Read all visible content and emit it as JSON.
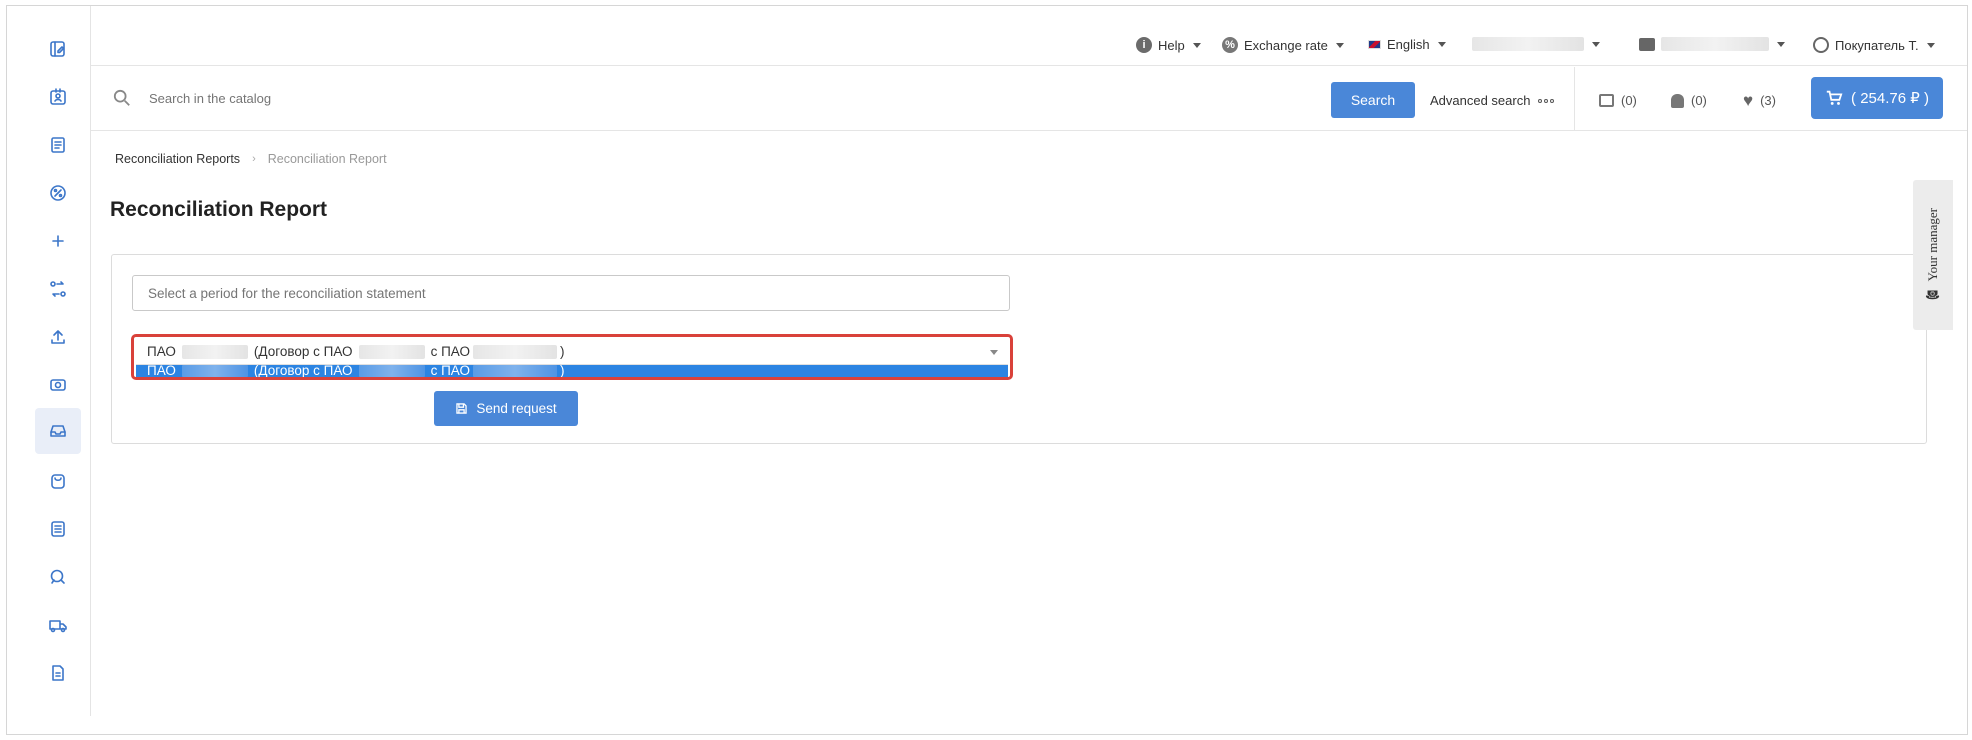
{
  "header": {
    "help_label": "Help",
    "exchange_label": "Exchange rate",
    "language_label": "English",
    "user_label": "Покупатель Т."
  },
  "search": {
    "placeholder": "Search in the catalog",
    "button_label": "Search",
    "advanced_label": "Advanced search"
  },
  "counters": {
    "compare": "(0)",
    "notifications": "(0)",
    "favorites": "(3)"
  },
  "cart": {
    "total": "( 254.76 ₽ )"
  },
  "breadcrumb": {
    "parent": "Reconciliation Reports",
    "current": "Reconciliation Report"
  },
  "page": {
    "title": "Reconciliation Report"
  },
  "form": {
    "period_placeholder": "Select a period for the reconciliation statement",
    "contract_part1": "ПАО",
    "contract_part2": "(Договор с ПАО",
    "contract_part3": "с ПАО",
    "contract_part4": ")",
    "send_label": "Send request"
  },
  "manager": {
    "label": "Your manager"
  },
  "colors": {
    "accent": "#4a87d8",
    "option_selected": "#2c84e2",
    "highlight": "#d9413a"
  }
}
